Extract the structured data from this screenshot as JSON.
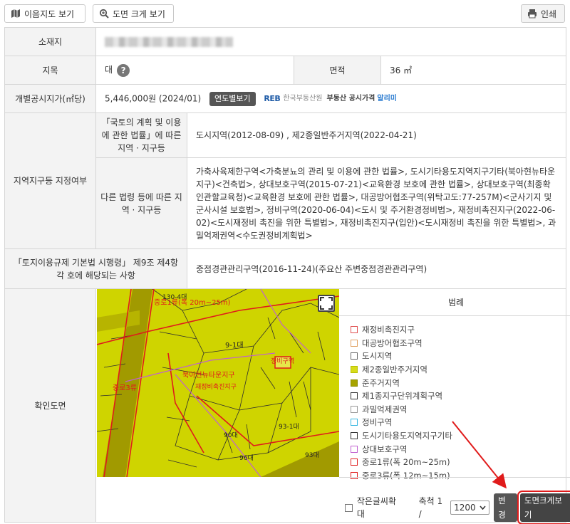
{
  "toolbar": {
    "landuse_label": "이음지도 보기",
    "zoom_label": "도면 크게 보기",
    "print_label": "인쇄"
  },
  "rows": {
    "location": {
      "label": "소재지",
      "value": ""
    },
    "jimok": {
      "label": "지목",
      "value": "대",
      "help": "?"
    },
    "area": {
      "label": "면적",
      "value": "36 ㎡"
    },
    "price": {
      "label": "개별공시지가(㎡당)",
      "value": "5,446,000원 (2024/01)",
      "button": "연도별보기",
      "reb_logo": "REB",
      "reb_org": "한국부동산원",
      "reb_service": "부동산 공시가격",
      "reb_alert": "알리미"
    },
    "zoning": {
      "label": "지역지구등 지정여부",
      "sub1_label": "「국토의 계획 및 이용에 관한 법률」에 따른 지역 · 지구등",
      "sub1_value": "도시지역(2012-08-09) , 제2종일반주거지역(2022-04-21)",
      "sub2_label": "다른 법령 등에 따른 지역 · 지구등",
      "sub2_value": "가축사육제한구역<가축분뇨의 관리 및 이용에 관한 법률>, 도시기타용도지역지구기타(북아현뉴타운지구)<건축법>, 상대보호구역(2015-07-21)<교육환경 보호에 관한 법률>, 상대보호구역(최종확인관할교육청)<교육환경 보호에 관한 법률>, 대공방어협조구역(위탁고도:77-257M)<군사기지 및 군사시설 보호법>, 정비구역(2020-06-04)<도시 및 주거환경정비법>, 재정비촉진지구(2022-06-02)<도시재정비 촉진을 위한 특별법>, 재정비촉진지구(입안)<도시재정비 촉진을 위한 특별법>, 과밀억제권역<수도권정비계획법>"
    },
    "enforcement": {
      "label": "「토지이용규제 기본법 시행령」 제9조 제4항 각 호에 해당되는 사항",
      "value": "중점경관관리구역(2016-11-24)(주요산 주변중점경관관리구역)"
    },
    "mapview": {
      "label": "확인도면"
    }
  },
  "legend": {
    "title": "범례",
    "items": [
      {
        "label": "재정비촉진지구",
        "border": "#e05050",
        "fill": "#ffffff"
      },
      {
        "label": "대공방어협조구역",
        "border": "#e0a060",
        "fill": "#ffffff"
      },
      {
        "label": "도시지역",
        "border": "#666666",
        "fill": "#ffffff"
      },
      {
        "label": "제2종일반주거지역",
        "border": "#b8c000",
        "fill": "#d8dc1a"
      },
      {
        "label": "준주거지역",
        "border": "#8a8a00",
        "fill": "#a6a300"
      },
      {
        "label": "제1종지구단위계획구역",
        "border": "#333333",
        "fill": "#ffffff"
      },
      {
        "label": "과밀억제권역",
        "border": "#999999",
        "fill": "#ffffff"
      },
      {
        "label": "정비구역",
        "border": "#36b6e0",
        "fill": "#ffffff"
      },
      {
        "label": "도시기타용도지역지구기타",
        "border": "#333333",
        "fill": "#ffffff"
      },
      {
        "label": "상대보호구역",
        "border": "#c060d0",
        "fill": "#ffffff"
      },
      {
        "label": "중로1류(폭 20m~25m)",
        "border": "#e02020",
        "fill": "#ffffff"
      },
      {
        "label": "중로3류(폭 12m~15m)",
        "border": "#e02020",
        "fill": "#ffffff"
      }
    ]
  },
  "controls": {
    "font_zoom_label": "작은글씨확대",
    "scale_label": "축척 1 /",
    "scale_value": "1200",
    "change_label": "변경",
    "big_map_label": "도면크게보기"
  },
  "map_labels": {
    "parcels": [
      "130-4대",
      "9-1대",
      "96대",
      "93-1대",
      "90대",
      "93대"
    ],
    "overlays": [
      "중로1류(폭 20m~25m)",
      "중로3류",
      "북아현뉴타운지구",
      "정비구역",
      "재정비촉진지구"
    ]
  },
  "colors": {
    "map_yellow": "#cfd400",
    "road_dark": "#a19a00",
    "highlight_red": "#e01b1b"
  }
}
